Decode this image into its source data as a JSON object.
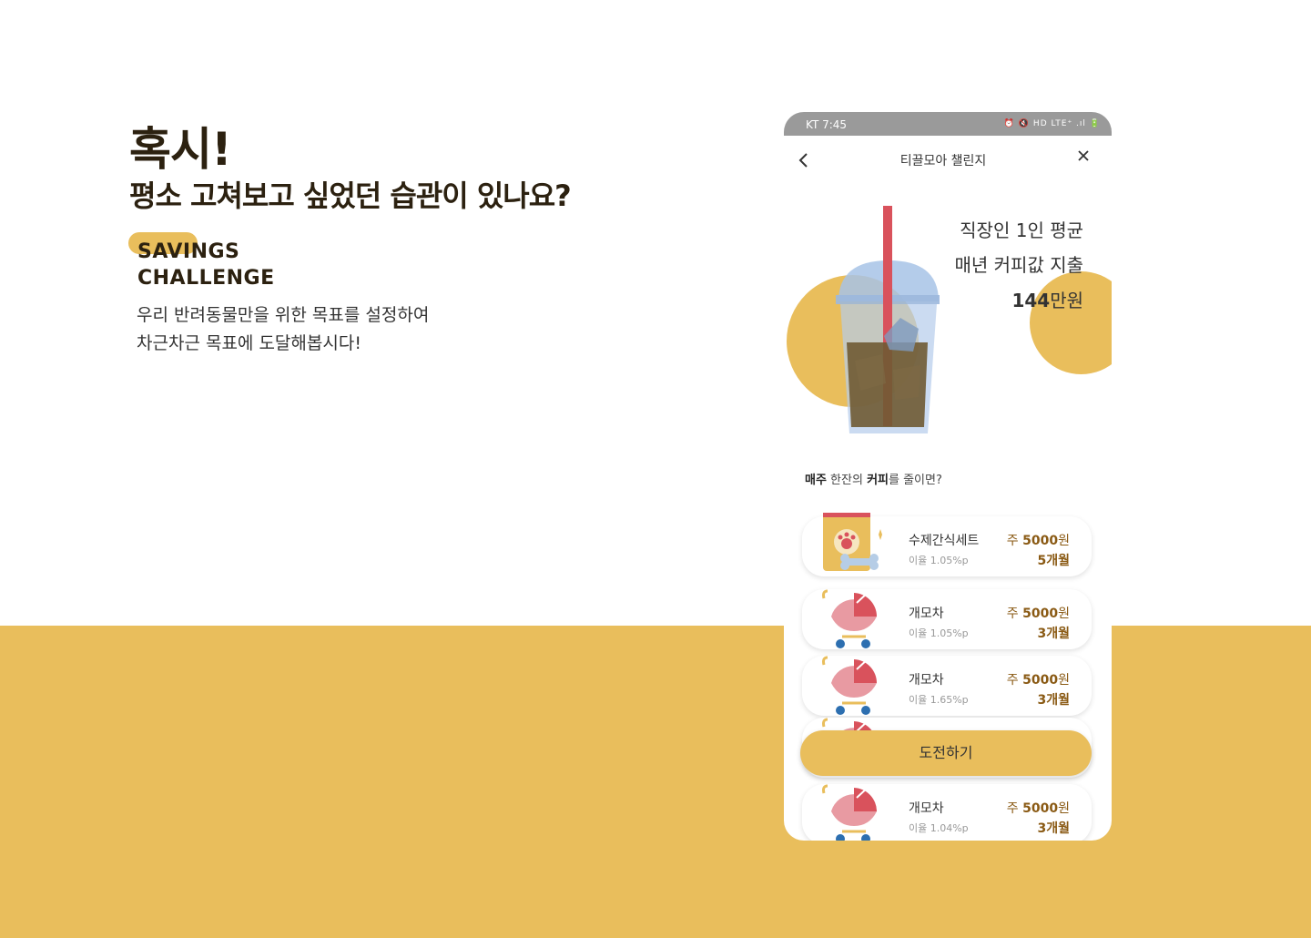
{
  "hero": {
    "title": "혹시!",
    "subtitle": "평소 고쳐보고 싶었던 습관이 있나요?",
    "badge_line1": "SAVINGS",
    "badge_line2": "CHALLENGE",
    "desc_line1": "우리 반려동물만을 위한 목표를 설정하여",
    "desc_line2": "차근차근 목표에 도달해봅시다!"
  },
  "colors": {
    "accent": "#e9be5c",
    "text_dark": "#2c2110",
    "amount": "#8a5a14"
  },
  "phone": {
    "status": {
      "carrier_time": "KT 7:45",
      "icons": "⏰ 🔇 HD LTE⁺ .ıl 🔋"
    },
    "nav": {
      "title": "티끌모아 챌린지",
      "back_icon": "chevron-left-icon",
      "close_icon": "close-icon"
    },
    "stat": {
      "line1": "직장인 1인 평균",
      "line2": "매년 커피값 지출",
      "value": "144",
      "unit": "만원"
    },
    "question": {
      "bold1": "매주",
      "text1": " 한잔의 ",
      "bold2": "커피",
      "text2": "를 줄이면?"
    },
    "cards": [
      {
        "name": "수제간식세트",
        "rate": "이율 1.05%p",
        "amount_prefix": "주 ",
        "amount": "5000",
        "currency": "원",
        "period": "5개월",
        "icon": "snack-bag-icon"
      },
      {
        "name": "개모차",
        "rate": "이율 1.05%p",
        "amount_prefix": "주 ",
        "amount": "5000",
        "currency": "원",
        "period": "3개월",
        "icon": "stroller-icon"
      },
      {
        "name": "개모차",
        "rate": "이율 1.65%p",
        "amount_prefix": "주 ",
        "amount": "5000",
        "currency": "원",
        "period": "3개월",
        "icon": "stroller-icon"
      },
      {
        "name": "개모차",
        "rate": "이율 1.04%p",
        "amount_prefix": "주 ",
        "amount": "5000",
        "currency": "원",
        "period": "3개월",
        "icon": "stroller-icon"
      }
    ],
    "cta": "도전하기"
  }
}
